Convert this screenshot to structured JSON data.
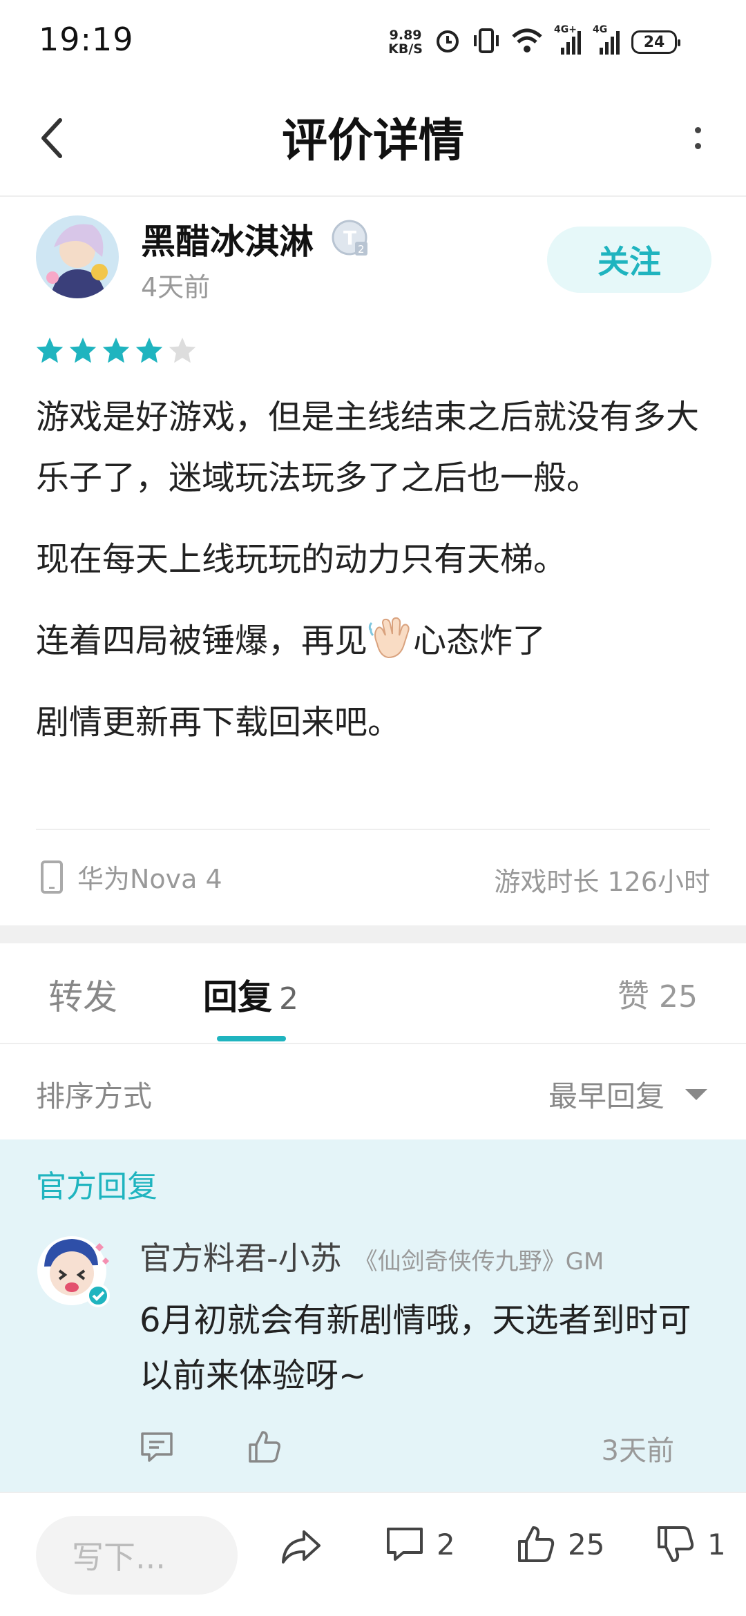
{
  "status_bar": {
    "time": "19:19",
    "net_speed_value": "9.89",
    "net_speed_unit": "KB/S",
    "signal_1": "4G+",
    "signal_2": "4G",
    "battery": "24"
  },
  "header": {
    "title": "评价详情"
  },
  "review": {
    "author": "黑醋冰淇淋",
    "level": "T2",
    "time": "4天前",
    "follow_label": "关注",
    "rating": 4,
    "rating_max": 5,
    "paragraphs": [
      "游戏是好游戏，但是主线结束之后就没有多大乐子了，迷域玩法玩多了之后也一般。",
      "现在每天上线玩玩的动力只有天梯。",
      "剧情更新再下载回来吧。"
    ],
    "para3_before": "连着四局被锤爆，再见",
    "para3_after": "心态炸了",
    "device": "华为Nova 4",
    "playtime": "游戏时长 126小时"
  },
  "tabs": {
    "forward": "转发",
    "reply": "回复",
    "reply_count": "2",
    "like": "赞",
    "like_count": "25"
  },
  "sort": {
    "label": "排序方式",
    "selected": "最早回复"
  },
  "official_reply": {
    "label": "官方回复",
    "name": "官方料君-小苏",
    "title": "《仙剑奇侠传九野》GM",
    "text": "6月初就会有新剧情哦，天选者到时可以前来体验呀~",
    "time": "3天前"
  },
  "bottom_bar": {
    "input_placeholder": "写下...",
    "comment_count": "2",
    "like_count": "25",
    "dislike_count": "1"
  },
  "colors": {
    "accent": "#1fb4bf",
    "star_filled": "#1fb4bf",
    "star_empty": "#dddddd",
    "official_bg": "#e4f4f8"
  }
}
